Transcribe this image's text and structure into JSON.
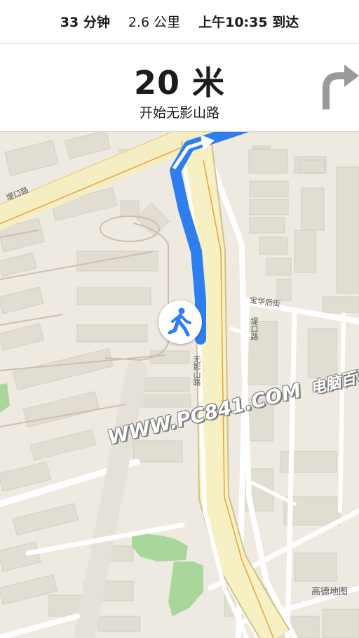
{
  "status_bar": {
    "duration": "33 分钟",
    "distance": "2.6 公里",
    "arrival": "上午10:35 到达"
  },
  "nav_card": {
    "distance": "20 米",
    "instruction": "开始无影山路",
    "turn_icon": "turn-right-arrow-icon"
  },
  "map": {
    "streets": {
      "ti_kou_lu": "堤口路",
      "bao_hua_hou_jie": "宝华后街",
      "ti_kou_lu_vertical": "堤口路",
      "wu_ying_shan_lu": "无影山路"
    },
    "route_color": "#2f7ef0",
    "walker_icon": "pedestrian-icon",
    "attribution": "高德地图"
  },
  "watermark": {
    "text": "WWW.PC841.COM",
    "cn_text": "电脑百事网"
  }
}
